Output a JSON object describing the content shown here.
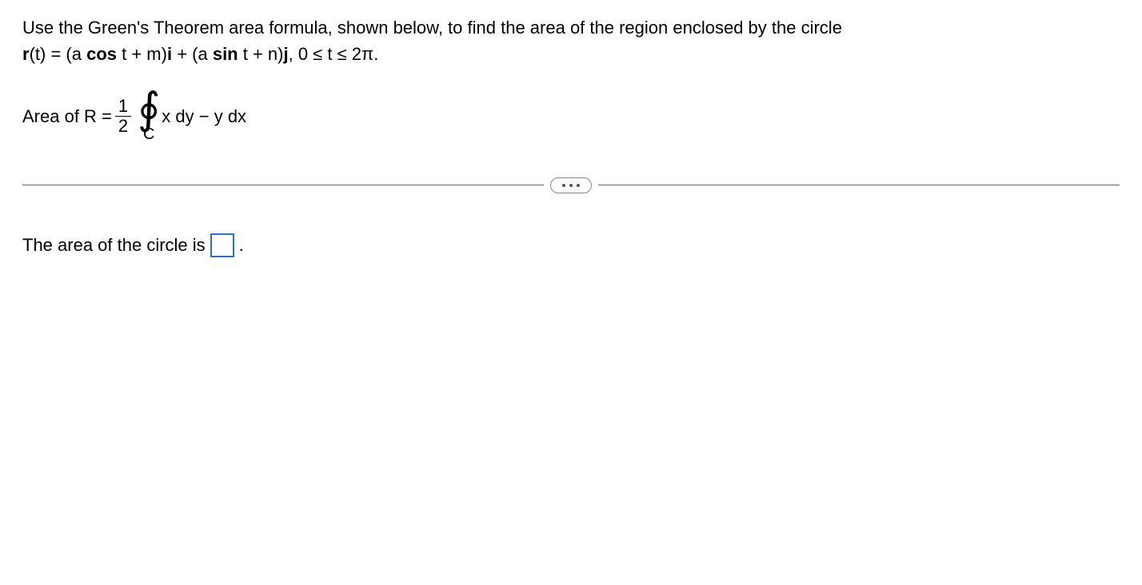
{
  "problem": {
    "line1": "Use the Green's Theorem area formula, shown below, to find the area of the region enclosed by the circle",
    "line2_prefix": "r",
    "line2_paren": "(t) = (a ",
    "line2_cos": "cos",
    "line2_mid1": " t + m)",
    "line2_i": "i",
    "line2_plus": " + (a ",
    "line2_sin": "sin",
    "line2_mid2": " t + n)",
    "line2_j": "j",
    "line2_range": ", 0 ≤ t ≤ 2π."
  },
  "formula": {
    "lhs": "Area of R = ",
    "frac_num": "1",
    "frac_den": "2",
    "integral_symbol": "∮",
    "integral_sub": "C",
    "integrand": "x dy − y dx"
  },
  "answer": {
    "prefix": "The area of the circle is ",
    "suffix": "."
  }
}
